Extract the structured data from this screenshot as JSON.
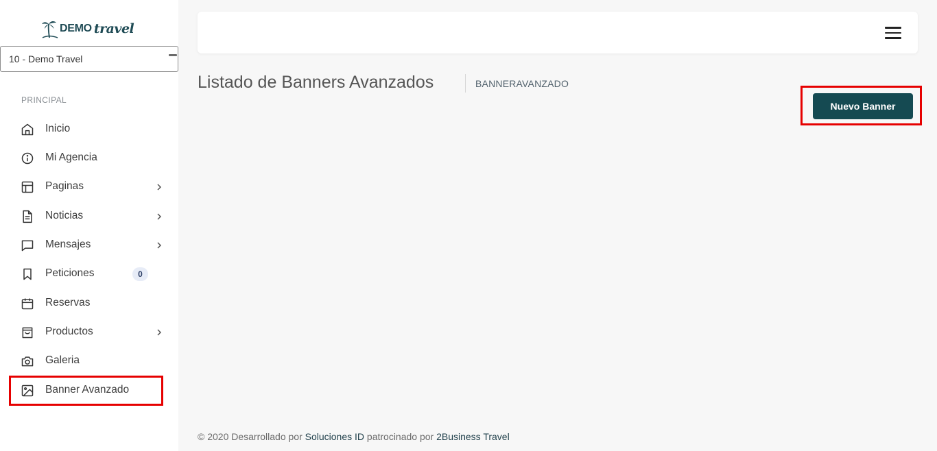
{
  "brand": {
    "name_a": "DEMO",
    "name_b": "travel"
  },
  "agency_select": {
    "value": "10 - Demo Travel"
  },
  "sidebar": {
    "section_label": "PRINCIPAL",
    "items": [
      {
        "label": "Inicio",
        "icon": "home-icon",
        "has_chevron": false
      },
      {
        "label": "Mi Agencia",
        "icon": "info-icon",
        "has_chevron": false
      },
      {
        "label": "Paginas",
        "icon": "layout-icon",
        "has_chevron": true
      },
      {
        "label": "Noticias",
        "icon": "file-text-icon",
        "has_chevron": true
      },
      {
        "label": "Mensajes",
        "icon": "message-icon",
        "has_chevron": true
      },
      {
        "label": "Peticiones",
        "icon": "bookmark-icon",
        "has_chevron": false,
        "badge": "0"
      },
      {
        "label": "Reservas",
        "icon": "calendar-icon",
        "has_chevron": false
      },
      {
        "label": "Productos",
        "icon": "shopping-bag-icon",
        "has_chevron": true
      },
      {
        "label": "Galeria",
        "icon": "camera-icon",
        "has_chevron": false
      },
      {
        "label": "Banner Avanzado",
        "icon": "image-icon",
        "has_chevron": false
      }
    ]
  },
  "header": {
    "menu_icon": "hamburger-icon"
  },
  "page": {
    "title": "Listado de Banners Avanzados",
    "breadcrumb": "BANNERAVANZADO",
    "new_button_label": "Nuevo Banner"
  },
  "footer": {
    "prefix": "© 2020 Desarrollado por ",
    "link1": "Soluciones ID",
    "middle": " patrocinado por ",
    "link2": "2Business Travel"
  },
  "colors": {
    "accent": "#154a52",
    "highlight": "#e60000",
    "background": "#f7f7f7"
  }
}
